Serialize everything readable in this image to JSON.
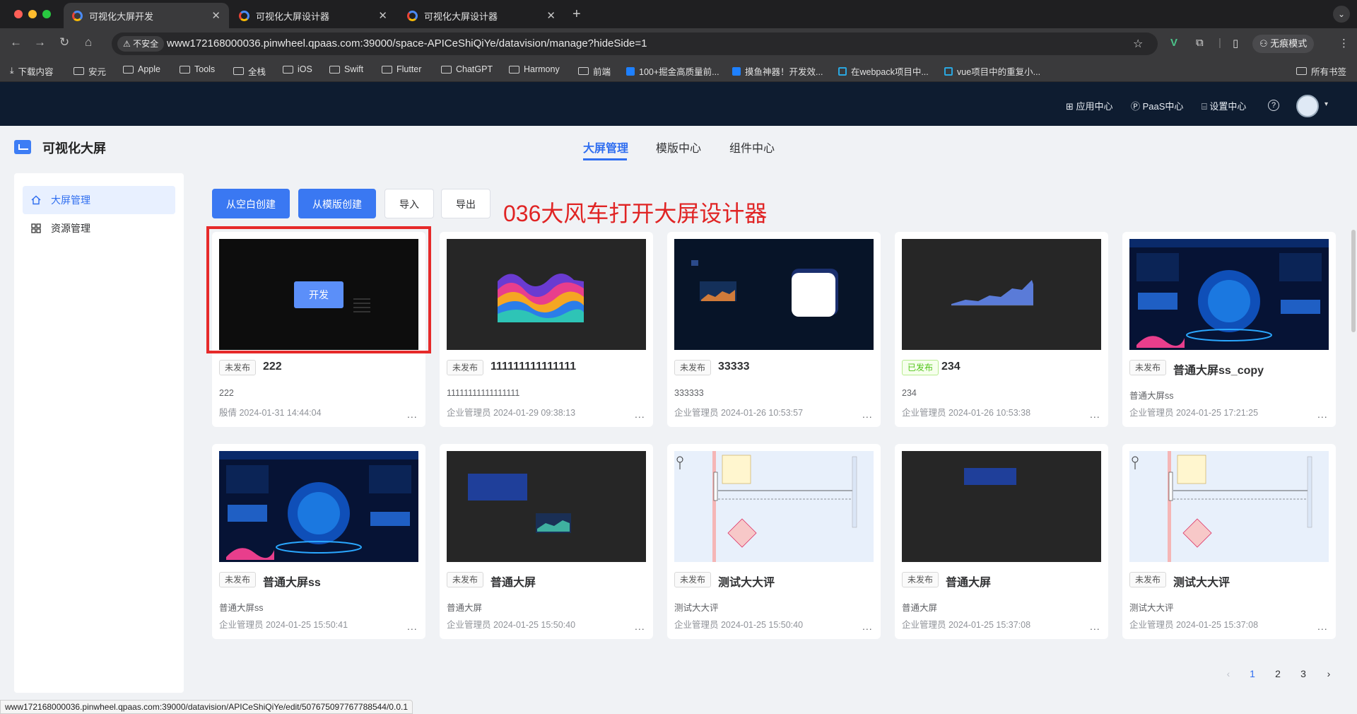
{
  "browser": {
    "tabs": [
      {
        "title": "可视化大屏开发",
        "active": true
      },
      {
        "title": "可视化大屏设计器",
        "active": false
      },
      {
        "title": "可视化大屏设计器",
        "active": false
      }
    ],
    "security_label": "不安全",
    "url": "www172168000036.pinwheel.qpaas.com:39000/space-APICeShiQiYe/datavision/manage?hideSide=1",
    "incognito_label": "无痕模式",
    "bookmarks": [
      "下载内容",
      "安元",
      "Apple",
      "Tools",
      "全栈",
      "iOS",
      "Swift",
      "Flutter",
      "ChatGPT",
      "Harmony",
      "前端",
      "100+掘金高质量前...",
      "摸鱼神器！开发效...",
      "在webpack项目中...",
      "vue项目中的重复小..."
    ],
    "all_bookmarks": "所有书签",
    "status_url": "www172168000036.pinwheel.qpaas.com:39000/datavision/APICeShiQiYe/edit/507675097767788544/0.0.1"
  },
  "header": {
    "nav": [
      "应用中心",
      "PaaS中心",
      "设置中心"
    ],
    "help_icon": "?"
  },
  "app": {
    "title": "可视化大屏",
    "tabs": [
      "大屏管理",
      "模版中心",
      "组件中心"
    ]
  },
  "sidebar": {
    "items": [
      {
        "label": "大屏管理",
        "icon": "home-icon",
        "active": true
      },
      {
        "label": "资源管理",
        "icon": "grid-icon",
        "active": false
      }
    ]
  },
  "toolbar": {
    "create_blank": "从空白创建",
    "create_template": "从模版创建",
    "import": "导入",
    "export": "导出"
  },
  "annotation": "036大风车打开大屏设计器",
  "hover_button": "开发",
  "cards": [
    {
      "status": "未发布",
      "name": "222",
      "desc": "222",
      "meta": "殷倩 2024-01-31 14:44:04"
    },
    {
      "status": "未发布",
      "name": "111111111111111",
      "desc": "11111111111111111",
      "meta": "企业管理员 2024-01-29 09:38:13"
    },
    {
      "status": "未发布",
      "name": "33333",
      "desc": "333333",
      "meta": "企业管理员 2024-01-26 10:53:57"
    },
    {
      "status": "已发布",
      "name": "234",
      "desc": "234",
      "meta": "企业管理员 2024-01-26 10:53:38"
    },
    {
      "status": "未发布",
      "name": "普通大屏ss_copy",
      "desc": "普通大屏ss",
      "meta": "企业管理员 2024-01-25 17:21:25"
    },
    {
      "status": "未发布",
      "name": "普通大屏ss",
      "desc": "普通大屏ss",
      "meta": "企业管理员 2024-01-25 15:50:41"
    },
    {
      "status": "未发布",
      "name": "普通大屏",
      "desc": "普通大屏",
      "meta": "企业管理员 2024-01-25 15:50:40"
    },
    {
      "status": "未发布",
      "name": "测试大大评",
      "desc": "测试大大评",
      "meta": "企业管理员 2024-01-25 15:50:40"
    },
    {
      "status": "未发布",
      "name": "普通大屏",
      "desc": "普通大屏",
      "meta": "企业管理员 2024-01-25 15:37:08"
    },
    {
      "status": "未发布",
      "name": "测试大大评",
      "desc": "测试大大评",
      "meta": "企业管理员 2024-01-25 15:37:08"
    }
  ],
  "card_more": "...",
  "pagination": {
    "prev": "‹",
    "pages": [
      "1",
      "2",
      "3"
    ],
    "current": "1",
    "next": "›"
  },
  "colors": {
    "primary": "#3a78f2",
    "header_bg": "#0e1c30",
    "annotation": "#e02424",
    "highlight": "#e62a2a"
  }
}
